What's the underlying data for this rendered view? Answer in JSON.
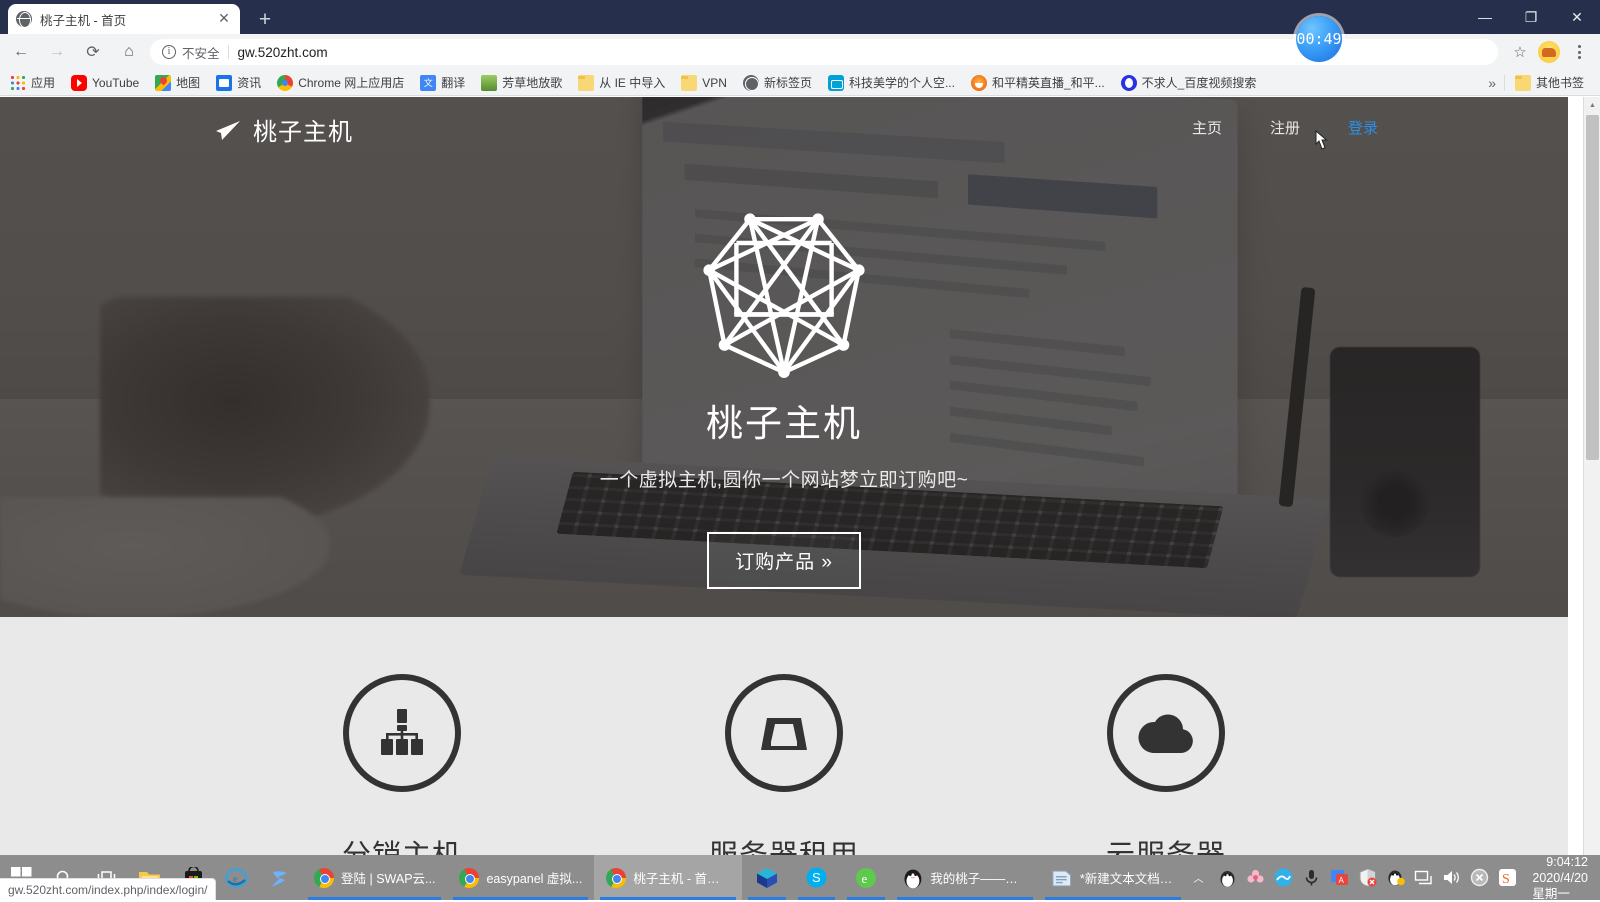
{
  "browser": {
    "tab": {
      "title": "桃子主机 - 首页",
      "favicon": "globe-icon",
      "close": "✕"
    },
    "new_tab_label": "+",
    "window_controls": {
      "minimize": "—",
      "maximize": "❐",
      "close": "✕"
    },
    "nav": {
      "back": "←",
      "forward": "→",
      "reload": "⟳",
      "home": "⌂"
    },
    "omnibox": {
      "security_icon": "i",
      "security_label": "不安全",
      "url": "gw.520zht.com"
    },
    "toolbar_icons": {
      "bookmark_star": "☆",
      "extension_avatar": "corgi-avatar",
      "menu": "⋮"
    },
    "bookmarks": [
      {
        "label": "应用",
        "icon": "apps-grid-icon"
      },
      {
        "label": "YouTube",
        "icon": "youtube-icon"
      },
      {
        "label": "地图",
        "icon": "maps-icon"
      },
      {
        "label": "资讯",
        "icon": "news-icon"
      },
      {
        "label": "Chrome 网上应用店",
        "icon": "chrome-icon"
      },
      {
        "label": "翻译",
        "icon": "translate-icon"
      },
      {
        "label": "芳草地放歌",
        "icon": "grass-icon"
      },
      {
        "label": "从 IE 中导入",
        "icon": "folder-icon"
      },
      {
        "label": "VPN",
        "icon": "folder-icon"
      },
      {
        "label": "新标签页",
        "icon": "globe-icon"
      },
      {
        "label": "科技美学的个人空...",
        "icon": "bilibili-icon"
      },
      {
        "label": "和平精英直播_和平...",
        "icon": "peace-icon"
      },
      {
        "label": "不求人_百度视频搜索",
        "icon": "baidu-icon"
      }
    ],
    "bookmarks_overflow": "»",
    "other_bookmarks": {
      "label": "其他书签",
      "icon": "folder-icon"
    },
    "status_bubble": "gw.520zht.com/index.php/index/login/",
    "scrollbar": {
      "up": "▲",
      "down": "▼"
    }
  },
  "overlay": {
    "timer": "00:49"
  },
  "site": {
    "brand": {
      "name": "桃子主机",
      "icon": "paper-plane-icon"
    },
    "nav_links": [
      {
        "label": "主页",
        "hovered": false
      },
      {
        "label": "注册",
        "hovered": false
      },
      {
        "label": "登录",
        "hovered": true
      }
    ],
    "hero": {
      "logo": "network-polygon-logo",
      "title": "桃子主机",
      "subtitle": "一个虚拟主机,圆你一个网站梦立即订购吧~",
      "cta": "订购产品 »"
    },
    "features": [
      {
        "label": "分销主机",
        "icon": "sitemap-icon"
      },
      {
        "label": "服务器租用",
        "icon": "inbox-icon"
      },
      {
        "label": "云服务器",
        "icon": "cloud-icon"
      }
    ]
  },
  "taskbar": {
    "start": "windows-logo-icon",
    "search": "search-icon",
    "taskview": "task-view-icon",
    "pinned": [
      {
        "name": "file-explorer-icon"
      },
      {
        "name": "microsoft-store-icon"
      },
      {
        "name": "internet-explorer-icon"
      },
      {
        "name": "xunlei-icon"
      }
    ],
    "apps": [
      {
        "label": "登陆 | SWAP云...",
        "icon": "chrome-icon",
        "active": false
      },
      {
        "label": "easypanel 虚拟...",
        "icon": "chrome-icon",
        "active": false
      },
      {
        "label": "桃子主机 - 首页 ...",
        "icon": "chrome-icon",
        "active": true
      },
      {
        "label": "",
        "icon": "yunxi-cube-icon",
        "active": false
      },
      {
        "label": "",
        "icon": "skype-icon",
        "active": false
      },
      {
        "label": "",
        "icon": "360-browser-icon",
        "active": false
      },
      {
        "label": "我的桃子——总...",
        "icon": "qq-icon",
        "active": false
      },
      {
        "label": "*新建文本文档 (...",
        "icon": "notepad-icon",
        "active": false
      }
    ],
    "tray": [
      {
        "name": "chevron-up-icon",
        "glyph": "︿"
      },
      {
        "name": "qq-tray-icon"
      },
      {
        "name": "flower-icon"
      },
      {
        "name": "wave-icon"
      },
      {
        "name": "microphone-icon"
      },
      {
        "name": "translate-tray-icon"
      },
      {
        "name": "security-shield-icon"
      },
      {
        "name": "qq-music-icon"
      },
      {
        "name": "network-icon"
      },
      {
        "name": "volume-icon"
      },
      {
        "name": "close-circle-icon"
      },
      {
        "name": "sogou-icon"
      }
    ],
    "clock": {
      "time": "9:04:12",
      "date": "2020/4/20 星期一"
    }
  }
}
